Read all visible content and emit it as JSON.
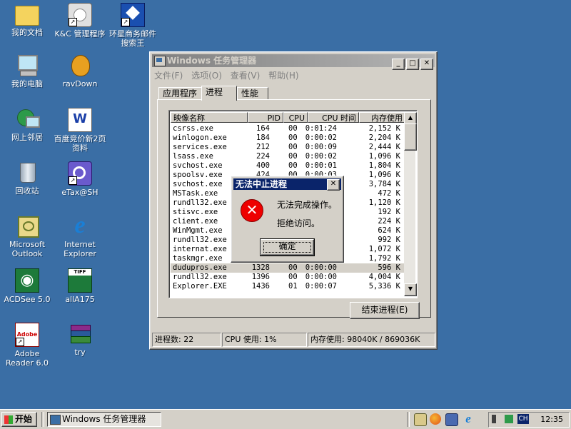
{
  "desktop": {
    "icons": [
      {
        "label": "我的文档"
      },
      {
        "label": "K&C 管理程序"
      },
      {
        "label": "环星商务邮件搜索王"
      },
      {
        "label": "我的电脑"
      },
      {
        "label": "ravDown"
      },
      {
        "label": "网上邻居"
      },
      {
        "label": "百度竞价新2页资料"
      },
      {
        "label": "回收站"
      },
      {
        "label": "eTax@SH"
      },
      {
        "label": "Microsoft Outlook"
      },
      {
        "label": "Internet Explorer"
      },
      {
        "label": "ACDSee 5.0"
      },
      {
        "label": "allA175"
      },
      {
        "label": "Adobe Reader 6.0"
      },
      {
        "label": "try"
      }
    ],
    "icon_glyphs": {
      "word": "W",
      "tiff": "TIFF",
      "adobe": "Adobe",
      "acdsee": "◉",
      "ie": "e"
    }
  },
  "taskmgr": {
    "title": "Windows 任务管理器",
    "caption_buttons": {
      "minimize": "_",
      "maximize": "□",
      "close": "✕"
    },
    "menu": [
      "文件(F)",
      "选项(O)",
      "查看(V)",
      "帮助(H)"
    ],
    "tabs": [
      "应用程序",
      "进程",
      "性能"
    ],
    "columns": [
      "映像名称",
      "PID",
      "CPU",
      "CPU 时间",
      "内存使用"
    ],
    "processes": [
      {
        "name": "csrss.exe",
        "pid": "164",
        "cpu": "00",
        "time": "0:01:24",
        "mem": "2,152 K"
      },
      {
        "name": "winlogon.exe",
        "pid": "184",
        "cpu": "00",
        "time": "0:00:02",
        "mem": "2,204 K"
      },
      {
        "name": "services.exe",
        "pid": "212",
        "cpu": "00",
        "time": "0:00:09",
        "mem": "2,444 K"
      },
      {
        "name": "lsass.exe",
        "pid": "224",
        "cpu": "00",
        "time": "0:00:02",
        "mem": "1,096 K"
      },
      {
        "name": "svchost.exe",
        "pid": "400",
        "cpu": "00",
        "time": "0:00:01",
        "mem": "1,804 K"
      },
      {
        "name": "spoolsv.exe",
        "pid": "424",
        "cpu": "00",
        "time": "0:00:03",
        "mem": "1,096 K"
      },
      {
        "name": "svchost.exe",
        "pid": "",
        "cpu": "",
        "time": "01",
        "mem": "3,784 K"
      },
      {
        "name": "MSTask.exe",
        "pid": "",
        "cpu": "",
        "time": "00",
        "mem": "472 K"
      },
      {
        "name": "rundll32.exe",
        "pid": "",
        "cpu": "",
        "time": "01",
        "mem": "1,120 K"
      },
      {
        "name": "stisvc.exe",
        "pid": "",
        "cpu": "",
        "time": "01",
        "mem": "192 K"
      },
      {
        "name": "client.exe",
        "pid": "",
        "cpu": "",
        "time": "01",
        "mem": "224 K"
      },
      {
        "name": "WinMgmt.exe",
        "pid": "",
        "cpu": "",
        "time": "06",
        "mem": "624 K"
      },
      {
        "name": "rundll32.exe",
        "pid": "",
        "cpu": "",
        "time": "17",
        "mem": "992 K"
      },
      {
        "name": "internat.exe",
        "pid": "",
        "cpu": "",
        "time": "00",
        "mem": "1,072 K"
      },
      {
        "name": "taskmgr.exe",
        "pid": "",
        "cpu": "",
        "time": "01",
        "mem": "1,792 K"
      },
      {
        "name": "dudupros.exe",
        "pid": "1328",
        "cpu": "00",
        "time": "0:00:00",
        "mem": "596 K"
      },
      {
        "name": "rundll32.exe",
        "pid": "1396",
        "cpu": "00",
        "time": "0:00:00",
        "mem": "4,004 K"
      },
      {
        "name": "Explorer.EXE",
        "pid": "1436",
        "cpu": "01",
        "time": "0:00:07",
        "mem": "5,336 K"
      }
    ],
    "selected_process": "dudupros.exe",
    "end_process_button": "结束进程(E)",
    "status": {
      "processes": "进程数: 22",
      "cpu": "CPU 使用: 1%",
      "memory": "内存使用: 98040K / 869036K"
    }
  },
  "dialog": {
    "title": "无法中止进程",
    "close": "✕",
    "icon": "✕",
    "message_line1": "无法完成操作。",
    "message_line2": "拒绝访问。",
    "ok_label": "确定"
  },
  "taskbar": {
    "start_label": "开始",
    "task_item": "Windows 任务管理器",
    "tray_lang": "CH",
    "clock": "12:35"
  },
  "colors": {
    "desktop": "#3a6ea5",
    "dialog_title": "#0a246a",
    "error_red": "#e00000"
  }
}
